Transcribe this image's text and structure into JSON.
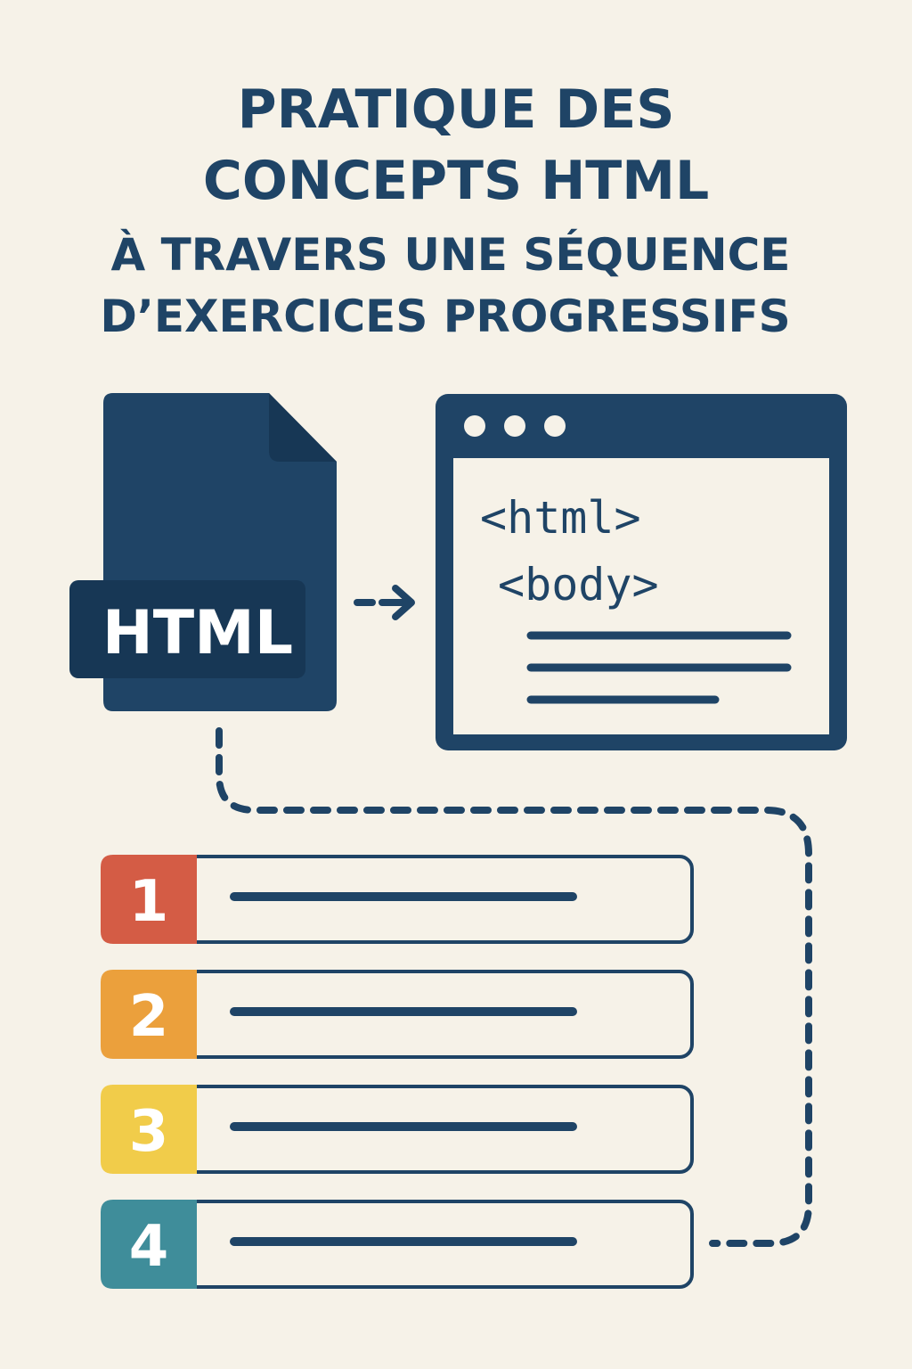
{
  "header": {
    "title_line1": "PRATIQUE DES",
    "title_line2": "CONCEPTS HTML",
    "subtitle_line1": "À TRAVERS UNE SÉQUENCE",
    "subtitle_line2": "D’EXERCICES PROGRESSIFS"
  },
  "file": {
    "label": "HTML",
    "icon": "html-file-icon"
  },
  "browser": {
    "icon": "browser-window-icon",
    "code_line1": "<html>",
    "code_line2": "<body>"
  },
  "steps": [
    {
      "number": "1",
      "color": "#d45c45"
    },
    {
      "number": "2",
      "color": "#eba03c"
    },
    {
      "number": "3",
      "color": "#f1cc4a"
    },
    {
      "number": "4",
      "color": "#3f8d9a"
    }
  ],
  "colors": {
    "navy": "#1f4466",
    "dark_navy": "#173755",
    "background": "#f6f2e8"
  }
}
